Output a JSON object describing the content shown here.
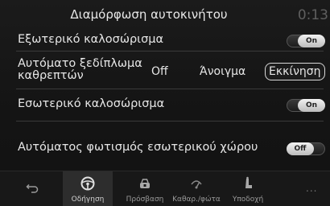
{
  "header": {
    "title": "Διαμόρφωση αυτοκινήτου",
    "clock": "0:13"
  },
  "settings": [
    {
      "label": "Εξωτερικό καλοσώρισμα",
      "toggle_label": "On"
    },
    {
      "label_line1": "Αυτόματο ξεδίπλωμα",
      "label_line2": "καθρεπτών",
      "options": [
        "Off",
        "Άνοιγμα",
        "Εκκίνηση"
      ],
      "selected": "Εκκίνηση"
    },
    {
      "label": "Εσωτερικό καλοσώρισμα",
      "toggle_label": "On"
    },
    {
      "label": "Αυτόματος φωτισμός εσωτερικού χώρου",
      "toggle_label": "Off"
    }
  ],
  "bottom_nav": {
    "back_icon": "back-arrow-icon",
    "items": [
      {
        "label": "Οδήγηση",
        "icon": "steering-wheel-icon",
        "active": true
      },
      {
        "label": "Πρόσβαση",
        "icon": "car-lock-icon"
      },
      {
        "label": "Καθαρ./φώτα",
        "icon": "wiper-icon"
      },
      {
        "label": "Υποδοχή",
        "icon": "seat-icon"
      }
    ],
    "more_label": "..."
  },
  "colors": {
    "background": "#141414",
    "text": "#e6e6e6",
    "toggle_knob": "#e0e0e0",
    "active_tab": "#2d2d2d"
  }
}
